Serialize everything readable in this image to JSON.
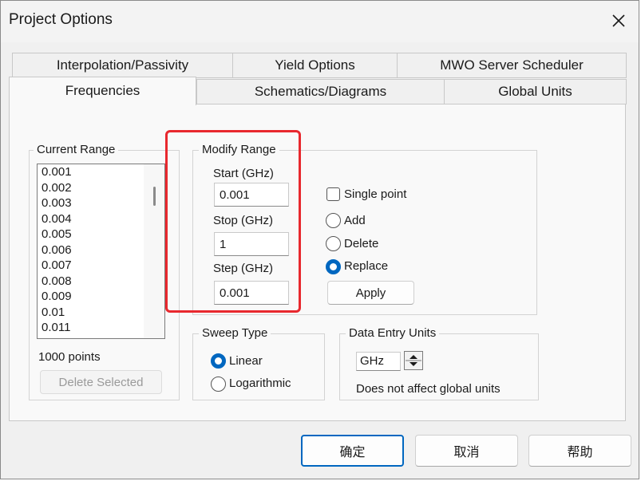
{
  "window": {
    "title": "Project Options"
  },
  "tabs": {
    "row_back": [
      "Interpolation/Passivity",
      "Yield Options",
      "MWO Server Scheduler"
    ],
    "row_front": [
      "Frequencies",
      "Schematics/Diagrams",
      "Global Units"
    ],
    "selected": "Frequencies"
  },
  "current_range": {
    "legend": "Current Range",
    "items": [
      "0.001",
      "0.002",
      "0.003",
      "0.004",
      "0.005",
      "0.006",
      "0.007",
      "0.008",
      "0.009",
      "0.01",
      "0.011"
    ],
    "count_label": "1000 points",
    "delete_button": "Delete Selected"
  },
  "modify_range": {
    "legend": "Modify Range",
    "start_label": "Start (GHz)",
    "start_value": "0.001",
    "stop_label": "Stop (GHz)",
    "stop_value": "1",
    "step_label": "Step (GHz)",
    "step_value": "0.001",
    "single_point_label": "Single point",
    "single_point_checked": false,
    "mode_options": [
      "Add",
      "Delete",
      "Replace"
    ],
    "mode_selected": "Replace",
    "apply_button": "Apply"
  },
  "sweep_type": {
    "legend": "Sweep Type",
    "options": [
      "Linear",
      "Logarithmic"
    ],
    "selected": "Linear"
  },
  "data_entry_units": {
    "legend": "Data Entry Units",
    "value": "GHz",
    "note": "Does not affect global units"
  },
  "footer": {
    "ok": "确定",
    "cancel": "取消",
    "help": "帮助"
  },
  "colors": {
    "accent": "#0067c0",
    "highlight": "#e8282e"
  }
}
